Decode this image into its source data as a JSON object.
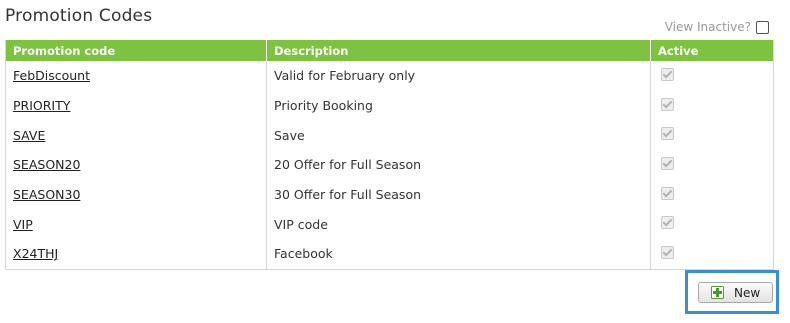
{
  "page": {
    "title": "Promotion Codes",
    "view_inactive_label": "View Inactive?"
  },
  "table": {
    "columns": [
      "Promotion code",
      "Description",
      "Active"
    ],
    "rows": [
      {
        "code": "FebDiscount",
        "description": "Valid for February only",
        "active": true
      },
      {
        "code": "PRIORITY",
        "description": "Priority Booking",
        "active": true
      },
      {
        "code": "SAVE",
        "description": "Save",
        "active": true
      },
      {
        "code": "SEASON20",
        "description": "20 Offer for Full Season",
        "active": true
      },
      {
        "code": "SEASON30",
        "description": "30 Offer for Full Season",
        "active": true
      },
      {
        "code": "VIP",
        "description": "VIP code",
        "active": true
      },
      {
        "code": "X24THJ",
        "description": "Facebook",
        "active": true
      }
    ]
  },
  "actions": {
    "new_label": "New",
    "new_icon": "add-document-icon"
  },
  "colors": {
    "header_bg": "#7dc241",
    "highlight": "#3d8ed0"
  }
}
